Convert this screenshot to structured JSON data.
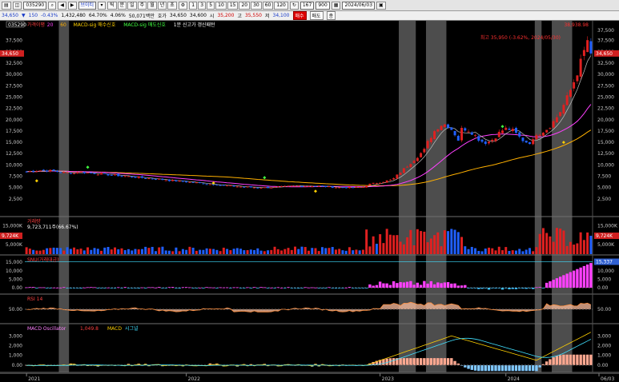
{
  "toolbar": {
    "code_value": "035290",
    "name_value": "브이티",
    "period_buttons": [
      "틱",
      "분",
      "일",
      "주",
      "월",
      "년",
      "초"
    ],
    "interval_buttons": [
      "1",
      "3",
      "5",
      "10",
      "15",
      "20",
      "30",
      "60",
      "120"
    ],
    "count_value": "167",
    "total_value": "900",
    "date_value": "2024/06/03"
  },
  "quote": {
    "price": "34,650",
    "change": "150",
    "change_pct": "-0.43%",
    "volume": "1,432,480",
    "vol_ratio": "64.70%",
    "rate": "4.06%",
    "amount": "50,071백만",
    "ask_label": "호가",
    "ask": "34,650",
    "bid": "34,600",
    "open_label": "시",
    "open": "35,200",
    "high_label": "고",
    "high": "35,550",
    "low_label": "저",
    "low": "34,100",
    "buy_label": "매수",
    "sell_label": "매도",
    "menu_label": "종"
  },
  "chart": {
    "price_panel": {
      "header_code": "035290",
      "legend": [
        {
          "text": "가격이평",
          "color": "#ff4040"
        },
        {
          "text": "20",
          "color": "#ff40ff"
        },
        {
          "text": "60",
          "color": "#ffb000"
        },
        {
          "text": "MACD-sig 매수신호",
          "color": "#ffd000"
        },
        {
          "text": "MACD-sig 매도신호",
          "color": "#40ff40"
        },
        {
          "text": "1분 신고가 갱신패턴",
          "color": "#ffffff"
        }
      ],
      "high_annotation": "최고 35,950 (-3.62%, 2024/05/30)",
      "y_ticks": [
        "37,500",
        "35,000",
        "32,500",
        "30,000",
        "27,500",
        "25,000",
        "22,500",
        "20,000",
        "17,500",
        "15,000",
        "12,500",
        "10,000",
        "7,500",
        "5,000",
        "2,500"
      ],
      "current_price_tag": "34,650",
      "left_tag": "34,650",
      "top_right_label": "38,938.98",
      "top_right_label2": "37,500"
    },
    "volume_panel": {
      "title": "거래량",
      "value_line": "9,723,711주(66.67%)",
      "y_ticks": [
        "15,000K",
        "10,000K",
        "5,000K"
      ],
      "left_tag": "9,724K",
      "right_tag": "9,724K"
    },
    "obv_panel": {
      "title": "SNU(거래대금)",
      "y_ticks": [
        "15,000",
        "10,000",
        "5,000",
        "0.00"
      ],
      "right_tag": "15,337"
    },
    "rsi_panel": {
      "title": "RSI 14",
      "y_ticks": [
        "50.00"
      ]
    },
    "macd_panel": {
      "title": "MACD Oscillator",
      "legend": [
        {
          "text": "MACD Oscillator",
          "color": "#ff80ff"
        },
        {
          "text": "1,049.8",
          "color": "#ff4040"
        },
        {
          "text": "MACD",
          "color": "#ffd000"
        },
        {
          "text": "시그널",
          "color": "#40e0ff"
        }
      ],
      "y_ticks": [
        "3,000",
        "2,000",
        "1,000",
        "0.00"
      ]
    },
    "x_ticks": [
      "2021",
      "2022",
      "2023",
      "2024",
      "06/03"
    ],
    "colors": {
      "up": "#e02020",
      "down": "#2060ff",
      "ma_short": "#ffffff",
      "ma20": "#ff40ff",
      "ma60": "#ffb000",
      "highlight_band": "#5a5a5a"
    }
  }
}
